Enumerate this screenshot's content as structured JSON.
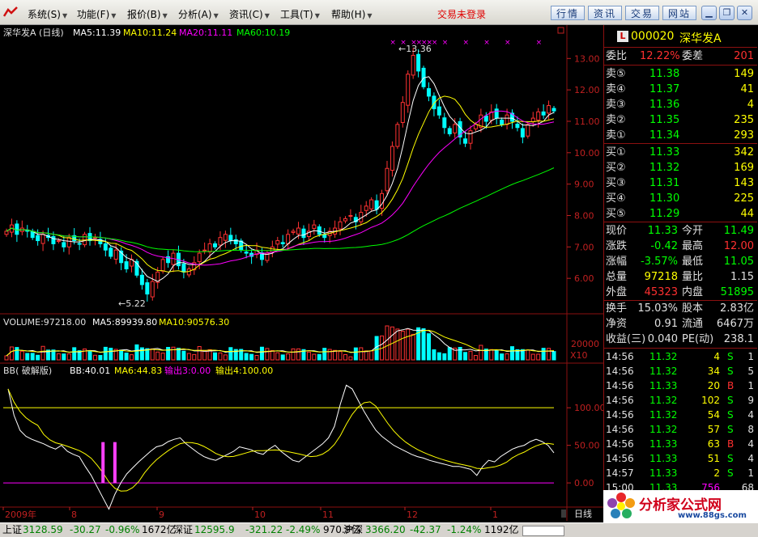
{
  "menu": [
    "系统(S)",
    "功能(F)",
    "报价(B)",
    "分析(A)",
    "资讯(C)",
    "工具(T)",
    "帮助(H)"
  ],
  "trade_status": "交易未登录",
  "toolbar_buttons": [
    "行情",
    "资讯",
    "交易",
    "网站"
  ],
  "chart": {
    "title_name": "深华发A (日线)",
    "ma_labels": [
      {
        "text": "MA5:11.39",
        "color": "#ffffff"
      },
      {
        "text": "MA10:11.24",
        "color": "#ffff00"
      },
      {
        "text": "MA20:11.11",
        "color": "#ff00ff"
      },
      {
        "text": "MA60:10.19",
        "color": "#00ff00"
      }
    ],
    "price_ticks": [
      "13.00",
      "12.00",
      "11.00",
      "10.00",
      "9.00",
      "8.00",
      "7.00",
      "6.00"
    ],
    "high_mark": "13.36",
    "low_mark": "5.22",
    "volume_title": "VOLUME:97218.00",
    "vol_ma_labels": [
      {
        "text": "MA5:89939.80",
        "color": "#ffffff"
      },
      {
        "text": "MA10:90576.30",
        "color": "#ffff00"
      }
    ],
    "vol_tick": "20000",
    "vol_unit": "X10",
    "bb_title": "BB( 破解版)",
    "bb_labels": [
      {
        "text": "BB:40.01",
        "color": "#ffffff"
      },
      {
        "text": "MA6:44.83",
        "color": "#ffff00"
      },
      {
        "text": "输出3:0.00",
        "color": "#ff00ff"
      },
      {
        "text": "输出4:100.00",
        "color": "#ffff00"
      }
    ],
    "bb_ticks": [
      "100.00",
      "50.00",
      "0.00"
    ],
    "date_labels": [
      "2009年",
      "8",
      "9",
      "10",
      "11",
      "12",
      "1"
    ],
    "period": "日线"
  },
  "chart_data": {
    "type": "candlestick",
    "price_range": [
      5.0,
      13.6
    ],
    "closes": [
      7.5,
      7.7,
      7.4,
      7.6,
      7.5,
      7.3,
      7.2,
      7.4,
      7.3,
      7.1,
      7.2,
      7.0,
      7.3,
      7.2,
      7.1,
      7.4,
      7.2,
      7.3,
      7.1,
      6.9,
      6.7,
      6.9,
      6.5,
      6.3,
      6.6,
      6.1,
      5.8,
      5.5,
      5.9,
      6.2,
      6.6,
      6.5,
      6.8,
      6.4,
      6.2,
      6.3,
      6.5,
      6.8,
      6.9,
      7.1,
      7.0,
      7.3,
      7.4,
      7.2,
      7.1,
      6.9,
      6.8,
      6.7,
      6.9,
      6.6,
      6.8,
      7.0,
      7.2,
      7.1,
      7.4,
      7.5,
      7.6,
      7.3,
      7.5,
      7.7,
      7.4,
      7.3,
      7.5,
      7.6,
      7.8,
      7.9,
      8.0,
      7.8,
      8.1,
      8.3,
      8.5,
      8.2,
      8.7,
      9.5,
      10.2,
      10.9,
      11.6,
      12.5,
      13.1,
      12.6,
      12.1,
      11.8,
      11.4,
      11.2,
      10.8,
      10.6,
      10.9,
      10.5,
      10.3,
      10.7,
      10.9,
      11.2,
      11.0,
      11.3,
      11.1,
      10.9,
      11.2,
      11.0,
      10.8,
      10.5,
      10.9,
      11.1,
      11.3,
      11.2,
      11.5,
      11.33
    ],
    "ma_last": {
      "MA5": 11.39,
      "MA10": 11.24,
      "MA20": 11.11,
      "MA60": 10.19
    },
    "volume_last": 97218.0,
    "bb_range": [
      -30,
      140
    ],
    "bb": [
      125,
      90,
      70,
      62,
      58,
      55,
      52,
      48,
      45,
      50,
      42,
      38,
      35,
      22,
      10,
      -5,
      -20,
      -35,
      -15,
      0,
      12,
      20,
      28,
      35,
      42,
      48,
      50,
      55,
      58,
      60,
      52,
      46,
      40,
      35,
      32,
      30,
      34,
      38,
      42,
      48,
      46,
      44,
      40,
      38,
      45,
      50,
      42,
      36,
      30,
      28,
      34,
      40,
      46,
      52,
      60,
      75,
      105,
      130,
      125,
      110,
      95,
      82,
      70,
      62,
      56,
      50,
      46,
      42,
      38,
      35,
      33,
      30,
      28,
      26,
      24,
      22,
      22,
      20,
      18,
      10,
      22,
      30,
      28,
      35,
      40,
      45,
      48,
      50,
      55,
      58,
      55,
      50,
      40
    ],
    "bb_signals": [
      -10,
      -8
    ]
  },
  "quote": {
    "badge": "L",
    "code": "000020",
    "name": "深华发A",
    "weibi_label": "委比",
    "weibi": "12.22%",
    "weicha_label": "委差",
    "weicha": "201",
    "sells": [
      {
        "label": "卖⑤",
        "price": "11.38",
        "vol": "149"
      },
      {
        "label": "卖④",
        "price": "11.37",
        "vol": "41"
      },
      {
        "label": "卖③",
        "price": "11.36",
        "vol": "4"
      },
      {
        "label": "卖②",
        "price": "11.35",
        "vol": "235"
      },
      {
        "label": "卖①",
        "price": "11.34",
        "vol": "293"
      }
    ],
    "buys": [
      {
        "label": "买①",
        "price": "11.33",
        "vol": "342"
      },
      {
        "label": "买②",
        "price": "11.32",
        "vol": "169"
      },
      {
        "label": "买③",
        "price": "11.31",
        "vol": "143"
      },
      {
        "label": "买④",
        "price": "11.30",
        "vol": "225"
      },
      {
        "label": "买⑤",
        "price": "11.29",
        "vol": "44"
      }
    ],
    "stats": [
      {
        "l1": "现价",
        "v1": "11.33",
        "c1": "#00ff00",
        "l2": "今开",
        "v2": "11.49",
        "c2": "#00ff00"
      },
      {
        "l1": "涨跌",
        "v1": "-0.42",
        "c1": "#00ff00",
        "l2": "最高",
        "v2": "12.00",
        "c2": "#ff3030"
      },
      {
        "l1": "涨幅",
        "v1": "-3.57%",
        "c1": "#00ff00",
        "l2": "最低",
        "v2": "11.05",
        "c2": "#00ff00"
      },
      {
        "l1": "总量",
        "v1": "97218",
        "c1": "#ffff00",
        "l2": "量比",
        "v2": "1.15",
        "c2": "#e0e0e0"
      },
      {
        "l1": "外盘",
        "v1": "45323",
        "c1": "#ff3030",
        "l2": "内盘",
        "v2": "51895",
        "c2": "#00ff00"
      }
    ],
    "fin": [
      {
        "l1": "换手",
        "v1": "15.03%",
        "l2": "股本",
        "v2": "2.83亿"
      },
      {
        "l1": "净资",
        "v1": "0.91",
        "l2": "流通",
        "v2": "6467万"
      },
      {
        "l1": "收益(三)",
        "v1": "0.040",
        "l2": "PE(动)",
        "v2": "238.1"
      }
    ]
  },
  "ticks": [
    {
      "time": "14:56",
      "price": "11.32",
      "vol": "4",
      "bs": "S",
      "n": "1"
    },
    {
      "time": "14:56",
      "price": "11.32",
      "vol": "34",
      "bs": "S",
      "n": "5"
    },
    {
      "time": "14:56",
      "price": "11.33",
      "vol": "20",
      "bs": "B",
      "n": "1"
    },
    {
      "time": "14:56",
      "price": "11.32",
      "vol": "102",
      "bs": "S",
      "n": "9"
    },
    {
      "time": "14:56",
      "price": "11.32",
      "vol": "54",
      "bs": "S",
      "n": "4"
    },
    {
      "time": "14:56",
      "price": "11.32",
      "vol": "57",
      "bs": "S",
      "n": "8"
    },
    {
      "time": "14:56",
      "price": "11.33",
      "vol": "63",
      "bs": "B",
      "n": "4"
    },
    {
      "time": "14:56",
      "price": "11.33",
      "vol": "51",
      "bs": "S",
      "n": "4"
    },
    {
      "time": "14:57",
      "price": "11.33",
      "vol": "2",
      "bs": "S",
      "n": "1"
    },
    {
      "time": "15:00",
      "price": "11.33",
      "vol": "756",
      "bs": "",
      "n": "68"
    }
  ],
  "logo": {
    "brand": "分析家公式网",
    "site": "www.88gs.com"
  },
  "status": {
    "sh_label": "上证",
    "sh_index": "3128.59",
    "sh_change": "-30.27",
    "sh_pct": "-0.96%",
    "sh_amount": "1672亿",
    "sz_label": "深证",
    "sz_index": "12595.9",
    "sz_change": "-321.22",
    "sz_pct": "-2.49%",
    "sz_amount": "970.9亿",
    "hs_label": "沪深",
    "hs_index": "3366.20",
    "hs_change": "-42.37",
    "hs_pct": "-1.24%",
    "hs_amount": "1192亿"
  }
}
